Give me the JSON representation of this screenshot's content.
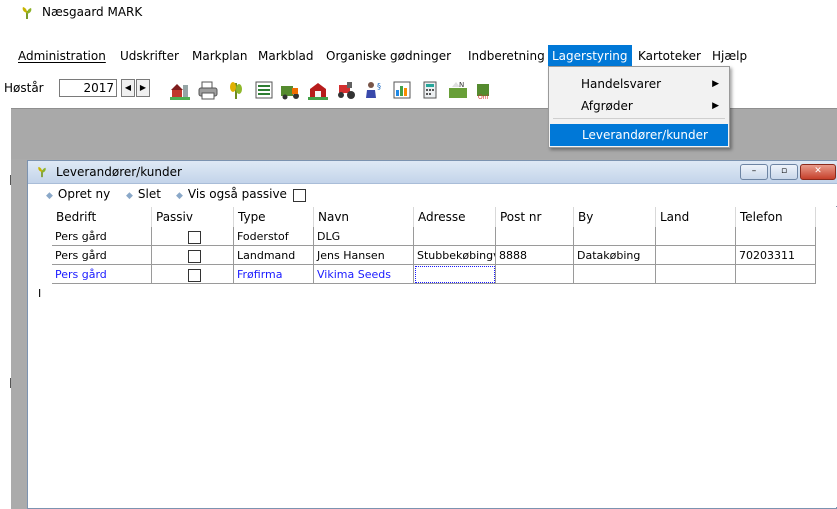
{
  "app": {
    "title": "Næsgaard MARK",
    "accent_color": "#0078d7"
  },
  "menubar": {
    "items": [
      {
        "label": "Administration",
        "name": "menu-administration"
      },
      {
        "label": "Udskrifter",
        "name": "menu-udskrifter"
      },
      {
        "label": "Markplan",
        "name": "menu-markplan"
      },
      {
        "label": "Markblad",
        "name": "menu-markblad"
      },
      {
        "label": "Organiske gødninger",
        "name": "menu-organiske-godninger"
      },
      {
        "label": "Indberetning",
        "name": "menu-indberetning"
      },
      {
        "label": "Lagerstyring",
        "name": "menu-lagerstyring"
      },
      {
        "label": "Kartoteker",
        "name": "menu-kartoteker"
      },
      {
        "label": "Hjælp",
        "name": "menu-hjaelp"
      }
    ],
    "active": "Lagerstyring"
  },
  "dropdown": {
    "items": [
      {
        "label": "Handelsvarer",
        "submenu": "▶"
      },
      {
        "label": "Afgrøder",
        "submenu": "▶"
      },
      {
        "label": "Leverandører/kunder",
        "submenu": ""
      }
    ],
    "highlighted": "Leverandører/kunder"
  },
  "toolbar": {
    "year_label": "Høstår",
    "year_value": "2017",
    "spin_left": "◀",
    "spin_right": "▶",
    "icons": [
      "farm-icon",
      "printer-icon",
      "crop-icon",
      "field-list-icon",
      "fertilizer-icon",
      "barn-icon",
      "machine-icon",
      "person-paragraph-icon",
      "chart-icon",
      "calculator-icon",
      "field-check-icon",
      "online-icon"
    ]
  },
  "child_window": {
    "title": "Leverandører/kunder",
    "minimize": "–",
    "maximize": "▫",
    "close": "✕"
  },
  "actions": {
    "new": "Opret ny",
    "delete": "Slet",
    "show_passive": "Vis også passive",
    "bullet": "◆"
  },
  "grid": {
    "columns": [
      "Bedrift",
      "Passiv",
      "Type",
      "Navn",
      "Adresse",
      "Post nr",
      "By",
      "Land",
      "Telefon"
    ],
    "rows": [
      {
        "bedrift": "Pers gård",
        "passiv": false,
        "type": "Foderstof",
        "navn": "DLG",
        "adresse": "",
        "postnr": "",
        "by": "",
        "land": "",
        "telefon": ""
      },
      {
        "bedrift": "Pers gård",
        "passiv": false,
        "type": "Landmand",
        "navn": "Jens Hansen",
        "adresse": "Stubbekøbingv",
        "postnr": "8888",
        "by": "Datakøbing",
        "land": "",
        "telefon": "70203311"
      },
      {
        "bedrift": "Pers gård",
        "passiv": false,
        "type": "Frøfirma",
        "navn": "Vikima Seeds",
        "adresse": "",
        "postnr": "",
        "by": "",
        "land": "",
        "telefon": ""
      }
    ],
    "row_indicator": "I"
  }
}
